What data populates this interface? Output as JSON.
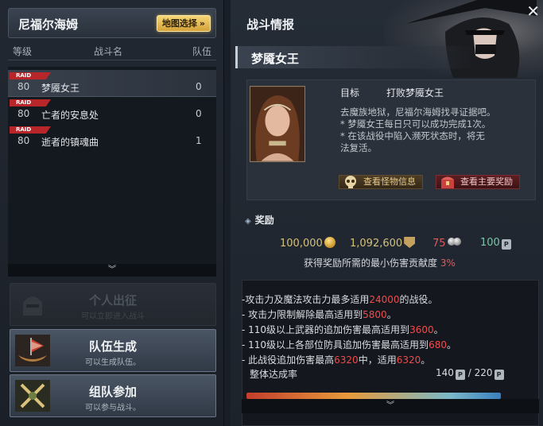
{
  "left_panel": {
    "region_title": "尼福尔海姆",
    "map_button": "地图选择",
    "columns": {
      "level": "等级",
      "name": "战斗名",
      "party": "队伍"
    },
    "rows": [
      {
        "badge": "RAID",
        "level": "80",
        "name": "梦魇女王",
        "party": "0",
        "selected": true
      },
      {
        "badge": "RAID",
        "level": "80",
        "name": "亡者的安息处",
        "party": "0",
        "selected": false
      },
      {
        "badge": "RAID",
        "level": "80",
        "name": "逝者的镇魂曲",
        "party": "1",
        "selected": false
      }
    ],
    "buttons": {
      "solo": {
        "title": "个人出征",
        "sub": "可以立即进入战斗",
        "enabled": false
      },
      "create_party": {
        "title": "队伍生成",
        "sub": "可以生成队伍。",
        "enabled": true
      },
      "join_party": {
        "title": "组队参加",
        "sub": "可以参与战斗。",
        "enabled": true
      }
    }
  },
  "right_panel": {
    "title": "战斗情报",
    "boss_name": "梦魇女王",
    "goal_label": "目标",
    "goal_value": "打败梦魇女王",
    "description": [
      "去魔族地狱，尼福尔海姆找寻证据吧。",
      " * 梦魇女王每日只可以成功完成1次。",
      " * 在该战役中陷入濒死状态时，将无",
      "法复活。"
    ],
    "monster_info_button": "查看怪物信息",
    "main_reward_button": "查看主要奖励",
    "reward_title": "奖励",
    "rewards": {
      "gold": "100,000",
      "exp": "1,092,600",
      "ap": "75",
      "pt": "100"
    },
    "min_damage_text": "获得奖励所需的最小伤害贡献度",
    "min_damage_value": "3%",
    "rules": [
      {
        "before": "-攻击力及魔法攻击力最多适用",
        "value": "24000",
        "after": "的战役。"
      },
      {
        "before": "- 攻击力限制解除最高适用到",
        "value": "5800",
        "after": "。"
      },
      {
        "before": "- 110级以上武器的追加伤害最高适用到",
        "value": "3600",
        "after": "。"
      },
      {
        "before": "- 110级以上各部位防具追加伤害最高适用到",
        "value": "680",
        "after": "。"
      },
      {
        "before": "- 此战役追加伤害最高",
        "value": "6320",
        "mid": "中，适用",
        "value2": "6320",
        "after": "。"
      }
    ],
    "total_label": "整体达成率",
    "total_current": "140",
    "total_sep": "/",
    "total_max": "220",
    "pt_unit": "PT"
  },
  "colors": {
    "highlight_red": "#ef4b4b",
    "raid_badge": "#b8262a",
    "map_button_gold": "#e0b04a"
  },
  "icons": {
    "map_chevron": "»",
    "scroll_down": "︾",
    "close": "✕"
  }
}
